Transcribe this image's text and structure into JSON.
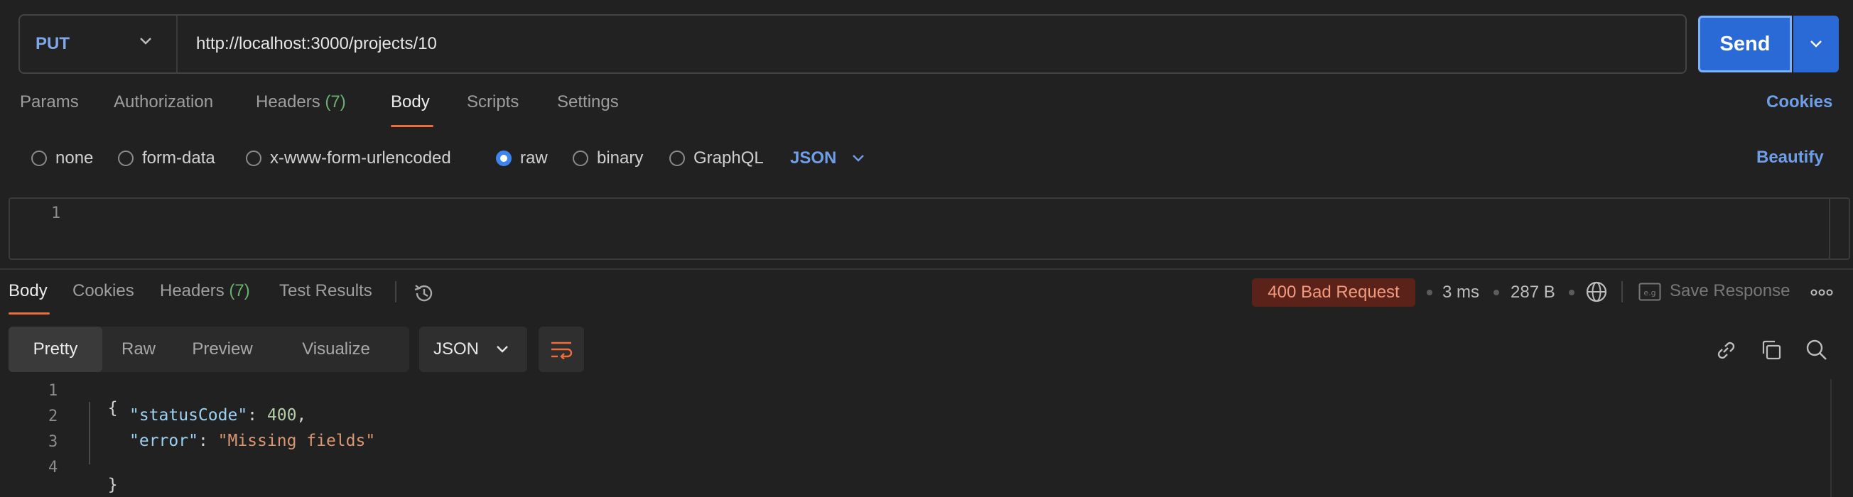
{
  "request": {
    "method": "PUT",
    "url": "http://localhost:3000/projects/10",
    "send_label": "Send"
  },
  "request_tabs": {
    "params": "Params",
    "authorization": "Authorization",
    "headers": "Headers",
    "headers_count": "(7)",
    "body": "Body",
    "scripts": "Scripts",
    "settings": "Settings",
    "cookies": "Cookies"
  },
  "body_types": {
    "none": "none",
    "form_data": "form-data",
    "urlencoded": "x-www-form-urlencoded",
    "raw": "raw",
    "binary": "binary",
    "graphql": "GraphQL",
    "selected": "raw",
    "language": "JSON",
    "beautify": "Beautify"
  },
  "request_editor": {
    "line_numbers": [
      "1"
    ]
  },
  "response_tabs": {
    "body": "Body",
    "cookies": "Cookies",
    "headers": "Headers",
    "headers_count": "(7)",
    "test_results": "Test Results"
  },
  "response_meta": {
    "status": "400 Bad Request",
    "time": "3 ms",
    "size": "287 B",
    "save_response": "Save Response"
  },
  "view_modes": {
    "pretty": "Pretty",
    "raw": "Raw",
    "preview": "Preview",
    "visualize": "Visualize",
    "format": "JSON"
  },
  "response_body": {
    "line_numbers": [
      "1",
      "2",
      "3",
      "4"
    ],
    "open_brace": "{",
    "close_brace": "}",
    "key1": "\"statusCode\"",
    "val1": "400",
    "key2": "\"error\"",
    "val2": "\"Missing fields\"",
    "colon": ": ",
    "comma": ","
  },
  "colors": {
    "accent": "#ef6c3c",
    "primary_button": "#2a6ad6",
    "link": "#6e9ee8",
    "error_badge_bg": "#5a2218",
    "error_badge_text": "#f29a7e",
    "count_green": "#67b36e"
  }
}
